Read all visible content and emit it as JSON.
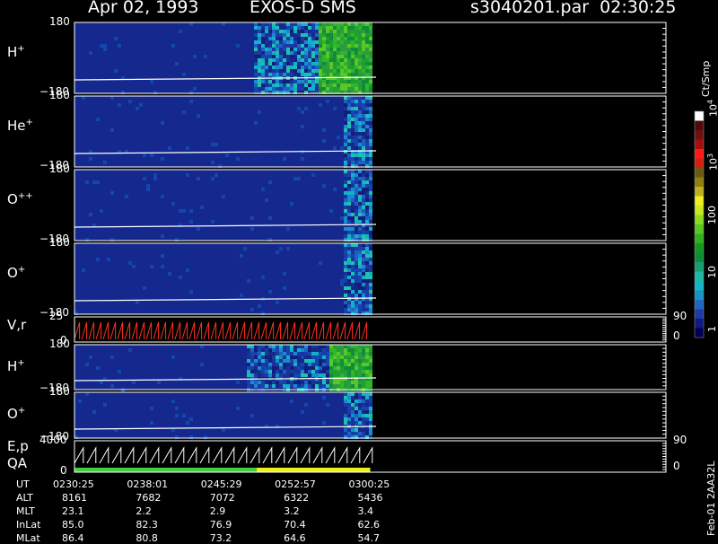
{
  "header": {
    "date": "Apr 02, 1993",
    "instrument": "EXOS-D SMS",
    "file_time": "s3040201.par  02:30:25"
  },
  "colorbar": {
    "unit": "Ct/Smp",
    "levels": [
      "1",
      "10",
      "100",
      "10",
      "10"
    ],
    "level_exponents": [
      "",
      "",
      "",
      "3",
      "4"
    ],
    "colors": [
      "#000050",
      "#101a80",
      "#1c3aa8",
      "#1f66c0",
      "#1694c4",
      "#14b6c6",
      "#20b8a0",
      "#14a070",
      "#0e8c38",
      "#129a20",
      "#30b020",
      "#58c820",
      "#8ada20",
      "#c8e820",
      "#f0f020",
      "#c0b020",
      "#8c8010",
      "#6a5a10",
      "#d02010",
      "#ff1818",
      "#a01010",
      "#701010",
      "#500a0a",
      "#ffffff"
    ]
  },
  "footer": {
    "version": "Feb-01 2AA32L"
  },
  "chart_data": {
    "type": "heatmap",
    "time_axis": {
      "ticks": [
        "0230:25",
        "0238:01",
        "0245:29",
        "0252:57",
        "0300:25"
      ]
    },
    "panels": [
      {
        "label": "H",
        "sup": "+",
        "ytop": "180",
        "ybot": "−180",
        "section": "upper",
        "data_end": 0.99,
        "onset": 0.6
      },
      {
        "label": "He",
        "sup": "+",
        "ytop": "180",
        "ybot": "−180",
        "section": "upper",
        "data_end": 0.99,
        "onset": 0.9
      },
      {
        "label": "O",
        "sup": "++",
        "ytop": "180",
        "ybot": "−180",
        "section": "upper",
        "data_end": 0.99,
        "onset": 0.9
      },
      {
        "label": "O",
        "sup": "+",
        "ytop": "180",
        "ybot": "−180",
        "section": "upper",
        "data_end": 0.99,
        "onset": 0.9
      },
      {
        "label": "V,r",
        "sup": "",
        "ytop": "25",
        "ybot": "0",
        "section": "line",
        "right_top": "90",
        "right_bot": "0",
        "data_end": 0.99
      },
      {
        "label": "H",
        "sup": "+",
        "ytop": "180",
        "ybot": "−180",
        "section": "lower",
        "data_end": 0.99,
        "onset": 0.58
      },
      {
        "label": "O",
        "sup": "+",
        "ytop": "180",
        "ybot": "−180",
        "section": "lower",
        "data_end": 0.99,
        "onset": 0.9
      },
      {
        "label": "E,p",
        "sublabel": "QA",
        "sup": "",
        "ytop": "4000",
        "ybot": "0",
        "section": "line",
        "right_top": "90",
        "right_bot": "0",
        "data_end": 0.99
      }
    ],
    "orbit_table": {
      "rows": [
        {
          "name": "UT",
          "values": [
            "0230:25",
            "0238:01",
            "0245:29",
            "0252:57",
            "0300:25"
          ]
        },
        {
          "name": "ALT",
          "values": [
            "8161",
            "7682",
            "7072",
            "6322",
            "5436"
          ]
        },
        {
          "name": "MLT",
          "values": [
            "23.1",
            "2.2",
            "2.9",
            "3.2",
            "3.4"
          ]
        },
        {
          "name": "InLat",
          "values": [
            "85.0",
            "82.3",
            "76.9",
            "70.4",
            "62.6"
          ]
        },
        {
          "name": "MLat",
          "values": [
            "86.4",
            "80.8",
            "73.2",
            "64.6",
            "54.7"
          ]
        }
      ]
    },
    "qa_segments": [
      {
        "from": 0.0,
        "to": 0.61,
        "color": "#40d040"
      },
      {
        "from": 0.61,
        "to": 0.99,
        "color": "#f0f020"
      }
    ]
  }
}
